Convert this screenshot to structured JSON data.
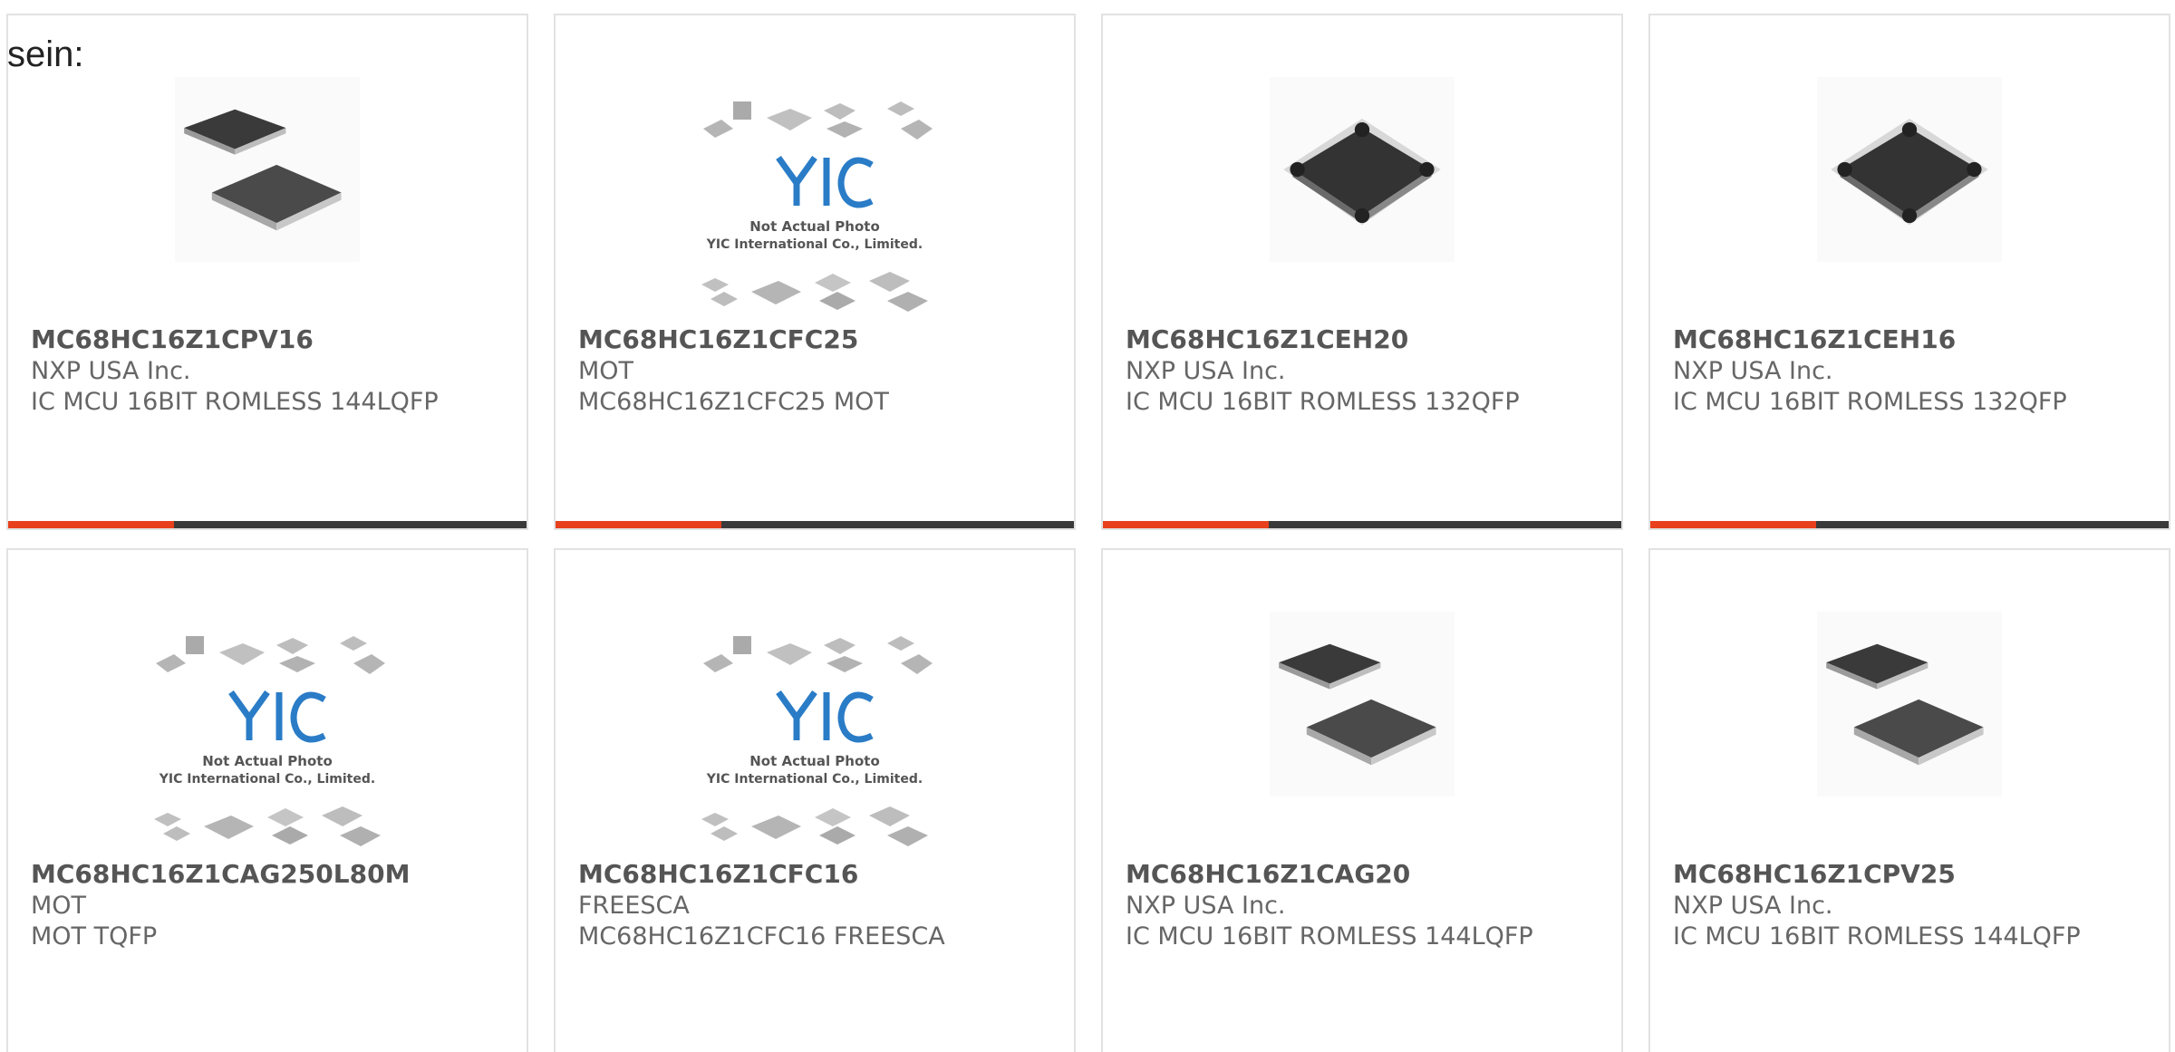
{
  "intro": {
    "text": "sein:"
  },
  "colors": {
    "accent": "#e8401c",
    "bar": "#3a3a3a",
    "border": "#e2e2e2",
    "part_number": "#555555",
    "text": "#666666",
    "yic_logo": "#2a7cc7"
  },
  "placeholder_image": {
    "icon": "yic-placeholder-icon",
    "line1": "Not Actual Photo",
    "line2": "YIC International Co., Limited."
  },
  "products": [
    {
      "part_number": "MC68HC16Z1CPV16",
      "manufacturer": "NXP USA Inc.",
      "description": "IC MCU 16BIT ROMLESS 144LQFP",
      "image": "lqfp-chip-icon"
    },
    {
      "part_number": "MC68HC16Z1CFC25",
      "manufacturer": "MOT",
      "description": "MC68HC16Z1CFC25 MOT",
      "image": "yic-placeholder-icon"
    },
    {
      "part_number": "MC68HC16Z1CEH20",
      "manufacturer": "NXP USA Inc.",
      "description": "IC MCU 16BIT ROMLESS 132QFP",
      "image": "qfp-chip-icon"
    },
    {
      "part_number": "MC68HC16Z1CEH16",
      "manufacturer": "NXP USA Inc.",
      "description": "IC MCU 16BIT ROMLESS 132QFP",
      "image": "qfp-chip-icon"
    },
    {
      "part_number": "MC68HC16Z1CAG250L80M",
      "manufacturer": "MOT",
      "description": "MOT TQFP",
      "image": "yic-placeholder-icon"
    },
    {
      "part_number": "MC68HC16Z1CFC16",
      "manufacturer": "FREESCA",
      "description": "MC68HC16Z1CFC16 FREESCA",
      "image": "yic-placeholder-icon"
    },
    {
      "part_number": "MC68HC16Z1CAG20",
      "manufacturer": "NXP USA Inc.",
      "description": "IC MCU 16BIT ROMLESS 144LQFP",
      "image": "lqfp-chip-icon"
    },
    {
      "part_number": "MC68HC16Z1CPV25",
      "manufacturer": "NXP USA Inc.",
      "description": "IC MCU 16BIT ROMLESS 144LQFP",
      "image": "lqfp-chip-icon"
    }
  ]
}
